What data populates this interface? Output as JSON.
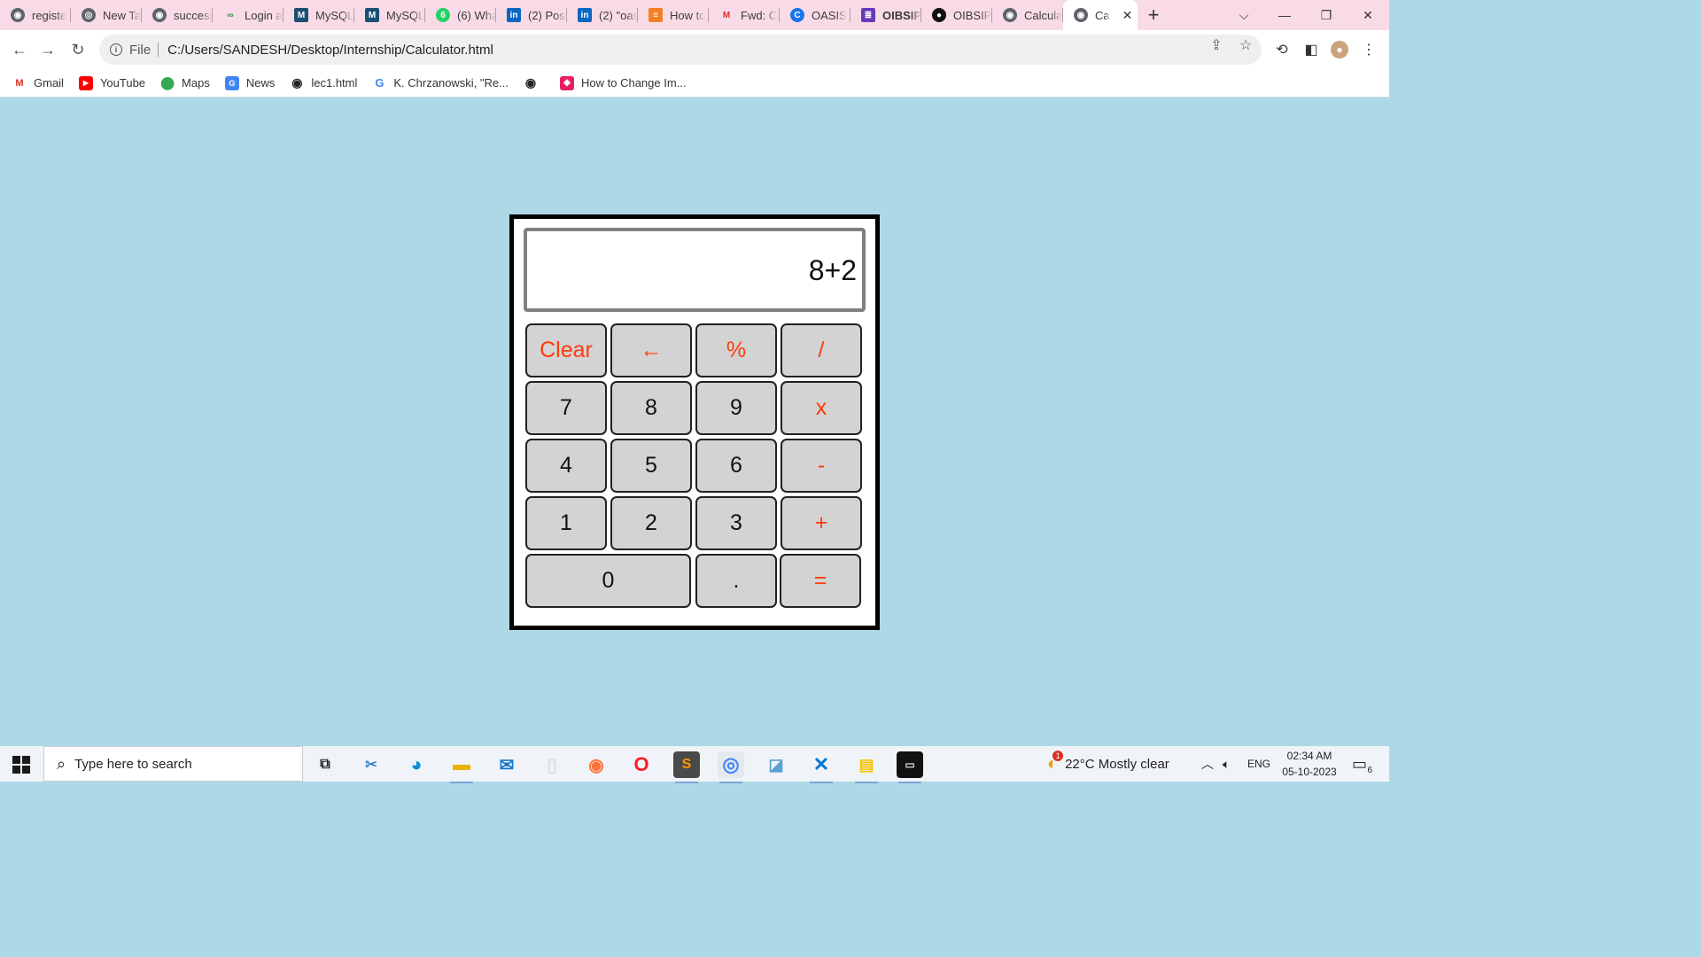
{
  "browser": {
    "tabs": [
      {
        "label": "registe",
        "icon": "globe-icon"
      },
      {
        "label": "New Ta",
        "icon": "chrome-icon"
      },
      {
        "label": "success",
        "icon": "globe-icon"
      },
      {
        "label": "Login a",
        "icon": "gfg-icon"
      },
      {
        "label": "MySQL",
        "icon": "mysql-icon"
      },
      {
        "label": "MySQL",
        "icon": "mysql-icon"
      },
      {
        "label": "(6) Wha",
        "icon": "whatsapp-icon"
      },
      {
        "label": "(2) Post",
        "icon": "linkedin-icon"
      },
      {
        "label": "(2) \"oas",
        "icon": "linkedin-icon"
      },
      {
        "label": "How to",
        "icon": "stackoverflow-icon"
      },
      {
        "label": "Fwd: C",
        "icon": "gmail-icon"
      },
      {
        "label": "OASIS",
        "icon": "oasis-icon"
      },
      {
        "label": "OIBSIP",
        "icon": "forms-icon"
      },
      {
        "label": "OIBSIP",
        "icon": "github-icon"
      },
      {
        "label": "Calcula",
        "icon": "globe-icon"
      }
    ],
    "active_tab": {
      "label": "Ca",
      "icon": "globe-icon"
    },
    "address": {
      "scheme": "File",
      "url": "C:/Users/SANDESH/Desktop/Internship/Calculator.html"
    },
    "bookmarks": [
      {
        "label": "Gmail",
        "icon": "gmail-icon"
      },
      {
        "label": "YouTube",
        "icon": "youtube-icon"
      },
      {
        "label": "Maps",
        "icon": "maps-icon"
      },
      {
        "label": "News",
        "icon": "news-icon"
      },
      {
        "label": "lec1.html",
        "icon": "globe-icon"
      },
      {
        "label": "K. Chrzanowski, \"Re...",
        "icon": "google-icon"
      },
      {
        "label": "",
        "icon": "globe-icon"
      },
      {
        "label": "How to Change Im...",
        "icon": "app-icon"
      }
    ]
  },
  "calculator": {
    "display": "8+2",
    "rows": [
      [
        {
          "label": "Clear",
          "op": true
        },
        {
          "label": "←",
          "op": true
        },
        {
          "label": "%",
          "op": true
        },
        {
          "label": "/",
          "op": true
        }
      ],
      [
        {
          "label": "7",
          "op": false
        },
        {
          "label": "8",
          "op": false
        },
        {
          "label": "9",
          "op": false
        },
        {
          "label": "x",
          "op": true
        }
      ],
      [
        {
          "label": "4",
          "op": false
        },
        {
          "label": "5",
          "op": false
        },
        {
          "label": "6",
          "op": false
        },
        {
          "label": "-",
          "op": true
        }
      ],
      [
        {
          "label": "1",
          "op": false
        },
        {
          "label": "2",
          "op": false
        },
        {
          "label": "3",
          "op": false
        },
        {
          "label": "+",
          "op": true
        }
      ],
      [
        {
          "label": "0",
          "op": false
        },
        {
          "label": ".",
          "op": false
        },
        {
          "label": "=",
          "op": true
        }
      ]
    ],
    "colors": {
      "page_bg": "#add8e6",
      "key_bg": "#d3d3d3",
      "operator_text": "#ff3b0f"
    }
  },
  "taskbar": {
    "search_placeholder": "Type here to search",
    "weather": "22°C  Mostly clear",
    "weather_badge": "1",
    "language": "ENG",
    "time": "02:34 AM",
    "date": "05-10-2023",
    "notifications": "6"
  }
}
